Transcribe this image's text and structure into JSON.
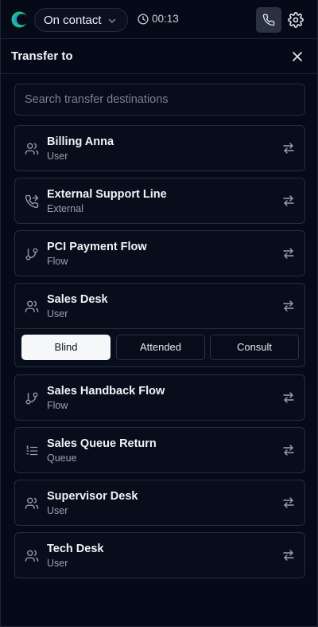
{
  "topbar": {
    "status_label": "On contact",
    "timer": "00:13"
  },
  "panel": {
    "title": "Transfer to"
  },
  "search": {
    "placeholder": "Search transfer destinations"
  },
  "destinations": [
    {
      "name": "Billing Anna",
      "type": "User",
      "icon": "users-icon"
    },
    {
      "name": "External Support Line",
      "type": "External",
      "icon": "phone-forward-icon"
    },
    {
      "name": "PCI Payment Flow",
      "type": "Flow",
      "icon": "git-branch-icon"
    },
    {
      "name": "Sales Desk",
      "type": "User",
      "icon": "users-icon",
      "expanded": true
    },
    {
      "name": "Sales Handback Flow",
      "type": "Flow",
      "icon": "git-branch-icon"
    },
    {
      "name": "Sales Queue Return",
      "type": "Queue",
      "icon": "list-icon"
    },
    {
      "name": "Supervisor Desk",
      "type": "User",
      "icon": "users-icon"
    },
    {
      "name": "Tech Desk",
      "type": "User",
      "icon": "users-icon"
    }
  ],
  "transfer_modes": {
    "blind": "Blind",
    "attended": "Attended",
    "consult": "Consult",
    "selected": "Blind"
  },
  "colors": {
    "background": "#060a18",
    "border": "#262d3d",
    "accent_green": "#1fc57e",
    "active_button": "#f6f7f9"
  }
}
